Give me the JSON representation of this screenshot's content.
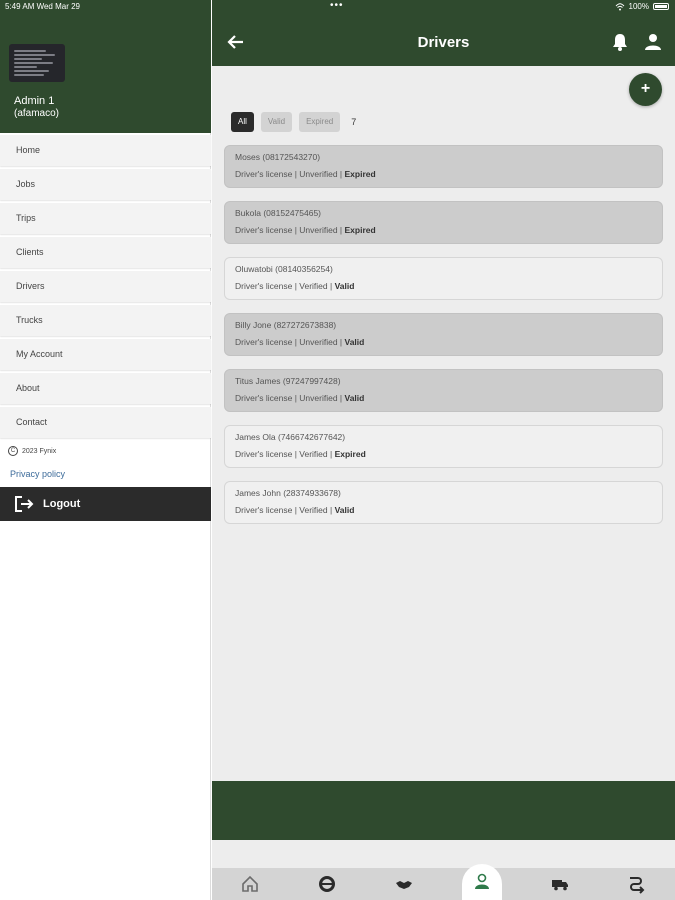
{
  "status_bar": {
    "time": "5:49 AM   Wed Mar 29",
    "dots": "•••",
    "battery": "100%"
  },
  "sidebar": {
    "admin_name": "Admin 1",
    "admin_username": "(afamaco)",
    "menu": [
      {
        "label": "Home"
      },
      {
        "label": "Jobs"
      },
      {
        "label": "Trips"
      },
      {
        "label": "Clients"
      },
      {
        "label": "Drivers"
      },
      {
        "label": "Trucks"
      },
      {
        "label": "My Account"
      },
      {
        "label": "About"
      },
      {
        "label": "Contact"
      }
    ],
    "copyright": "2023 Fynix",
    "copyright_symbol": "C",
    "privacy": "Privacy policy",
    "logout": "Logout"
  },
  "header": {
    "title": "Drivers"
  },
  "fab": {
    "label": "+"
  },
  "filters": {
    "all": "All",
    "valid": "Valid",
    "expired": "Expired",
    "count": "7"
  },
  "drivers": [
    {
      "name": "Moses (08172543270)",
      "doc": "Driver's license | Unverified | ",
      "status": "Expired"
    },
    {
      "name": "Bukola (08152475465)",
      "doc": "Driver's license | Unverified | ",
      "status": "Expired"
    },
    {
      "name": "Oluwatobi  (08140356254)",
      "doc": "Driver's license | Verified | ",
      "status": "Valid"
    },
    {
      "name": "Billy Jone (827272673838)",
      "doc": "Driver's license | Unverified | ",
      "status": "Valid"
    },
    {
      "name": "Titus James (97247997428)",
      "doc": "Driver's license | Unverified | ",
      "status": "Valid"
    },
    {
      "name": "James Ola (7466742677642)",
      "doc": "Driver's license | Verified | ",
      "status": "Expired"
    },
    {
      "name": "James John (28374933678)",
      "doc": "Driver's license | Verified | ",
      "status": "Valid"
    }
  ],
  "bottom_nav": [
    {
      "icon": "home-icon"
    },
    {
      "icon": "steering-wheel-icon"
    },
    {
      "icon": "handshake-icon"
    },
    {
      "icon": "driver-icon"
    },
    {
      "icon": "truck-icon"
    },
    {
      "icon": "route-icon"
    }
  ],
  "colors": {
    "primary": "#2f4a2e",
    "dark": "#2b2b2b",
    "background": "#ededed"
  }
}
